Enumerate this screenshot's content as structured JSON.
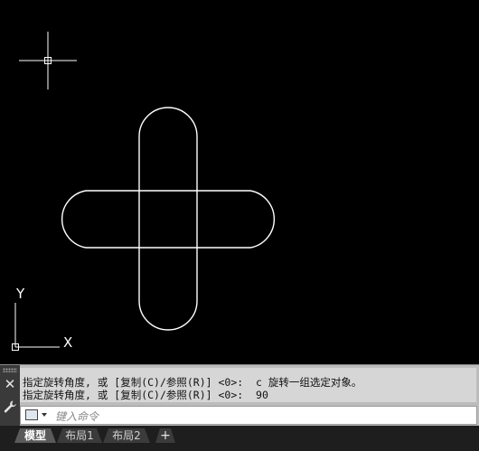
{
  "command_history": [
    "指定旋转角度, 或 [复制(C)/参照(R)] <0>:  c 旋转一组选定对象。",
    "指定旋转角度, 或 [复制(C)/参照(R)] <0>:  90"
  ],
  "command_line": {
    "placeholder": "键入命令",
    "value": ""
  },
  "ucs": {
    "x_label": "X",
    "y_label": "Y"
  },
  "tabs": [
    {
      "label": "模型",
      "active": true
    },
    {
      "label": "布局1",
      "active": false
    },
    {
      "label": "布局2",
      "active": false
    }
  ],
  "tab_add_label": "+",
  "colors": {
    "canvas_background": "#000000",
    "geometry_stroke": "#ffffff",
    "panel_background": "#bcbcbc"
  },
  "icons": {
    "close": "close-icon",
    "customize": "wrench-icon",
    "prompt": "command-prompt-icon",
    "crosshair": "crosshair-cursor-icon"
  }
}
